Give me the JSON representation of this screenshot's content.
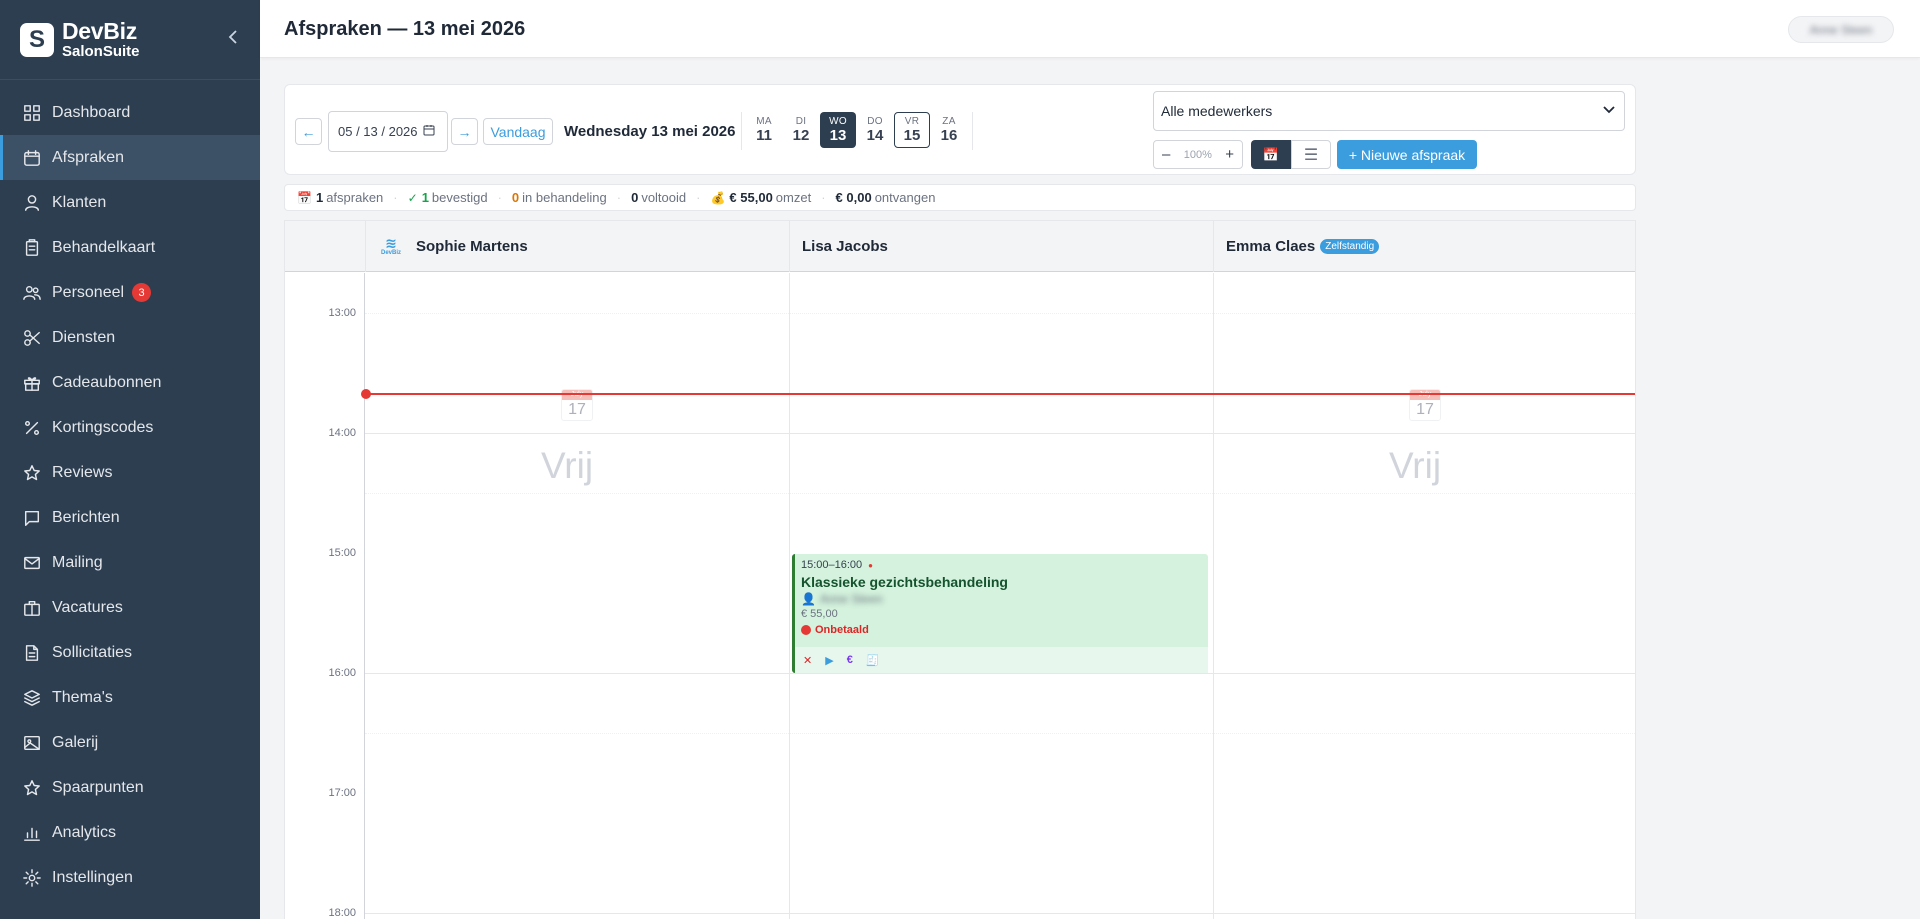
{
  "brand": {
    "name": "DevBiz",
    "sub": "SalonSuite",
    "logo_letter": "S"
  },
  "sidebar": {
    "items": [
      {
        "label": "Dashboard",
        "icon": "dashboard-icon"
      },
      {
        "label": "Afspraken",
        "icon": "calendar-icon",
        "active": true
      },
      {
        "label": "Klanten",
        "icon": "user-icon"
      },
      {
        "label": "Behandelkaart",
        "icon": "clipboard-icon"
      },
      {
        "label": "Personeel",
        "icon": "users-icon",
        "badge": "3"
      },
      {
        "label": "Diensten",
        "icon": "scissors-icon"
      },
      {
        "label": "Cadeaubonnen",
        "icon": "gift-icon"
      },
      {
        "label": "Kortingscodes",
        "icon": "percent-icon"
      },
      {
        "label": "Reviews",
        "icon": "star-icon"
      },
      {
        "label": "Berichten",
        "icon": "message-icon"
      },
      {
        "label": "Mailing",
        "icon": "mail-icon"
      },
      {
        "label": "Vacatures",
        "icon": "briefcase-icon"
      },
      {
        "label": "Sollicitaties",
        "icon": "document-icon"
      },
      {
        "label": "Thema's",
        "icon": "layers-icon"
      },
      {
        "label": "Galerij",
        "icon": "image-icon"
      },
      {
        "label": "Spaarpunten",
        "icon": "star-icon"
      },
      {
        "label": "Analytics",
        "icon": "chart-icon"
      },
      {
        "label": "Instellingen",
        "icon": "gear-icon"
      }
    ]
  },
  "header": {
    "title": "Afspraken — 13 mei 2026",
    "user": "Anne Steen"
  },
  "toolbar": {
    "prev": "←",
    "next": "→",
    "date_value": "05 / 13 / 2026",
    "today_label": "Vandaag",
    "date_label": "Wednesday 13 mei 2026",
    "week": [
      {
        "dn": "MA",
        "dd": "11"
      },
      {
        "dn": "DI",
        "dd": "12"
      },
      {
        "dn": "WO",
        "dd": "13",
        "selected": true
      },
      {
        "dn": "DO",
        "dd": "14"
      },
      {
        "dn": "VR",
        "dd": "15",
        "today": true
      },
      {
        "dn": "ZA",
        "dd": "16"
      }
    ],
    "staff_filter": "Alle medewerkers",
    "zoom_minus": "–",
    "zoom_value": "100%",
    "zoom_plus": "+",
    "view_calendar_icon": "📅",
    "view_list_icon": "☰",
    "new_label": "+ Nieuwe afspraak"
  },
  "stats": {
    "appointments": {
      "icon": "📅",
      "num": "1",
      "label": "afspraken"
    },
    "confirmed": {
      "icon": "✓",
      "num": "1",
      "label": "bevestigd"
    },
    "in_progress": {
      "num": "0",
      "label": "in behandeling"
    },
    "completed": {
      "num": "0",
      "label": "voltooid"
    },
    "revenue": {
      "icon": "💰",
      "num": "€ 55,00",
      "label": "omzet"
    },
    "received": {
      "num": "€ 0,00",
      "label": "ontvangen"
    }
  },
  "calendar": {
    "columns": [
      {
        "name": "Sophie Martens",
        "logo_text": "DevBiz"
      },
      {
        "name": "Lisa Jacobs"
      },
      {
        "name": "Emma Claes",
        "tag": "Zelfstandig"
      }
    ],
    "hours": [
      "13:00",
      "14:00",
      "15:00",
      "16:00",
      "17:00",
      "18:00"
    ],
    "free": {
      "month": "July",
      "day": "17",
      "label": "Vrij"
    },
    "appointment": {
      "time": "15:00–16:00",
      "title": "Klassieke gezichtsbehandeling",
      "client": "Anne Steen",
      "price": "€ 55,00",
      "status": "Onbetaald",
      "actions": [
        "✕",
        "▶",
        "€",
        "🧾"
      ]
    }
  },
  "colors": {
    "sidebar": "#2c3e50",
    "accent": "#3b9ddd",
    "now_line": "#e53935",
    "appointment_bg": "#d4f2dd"
  }
}
